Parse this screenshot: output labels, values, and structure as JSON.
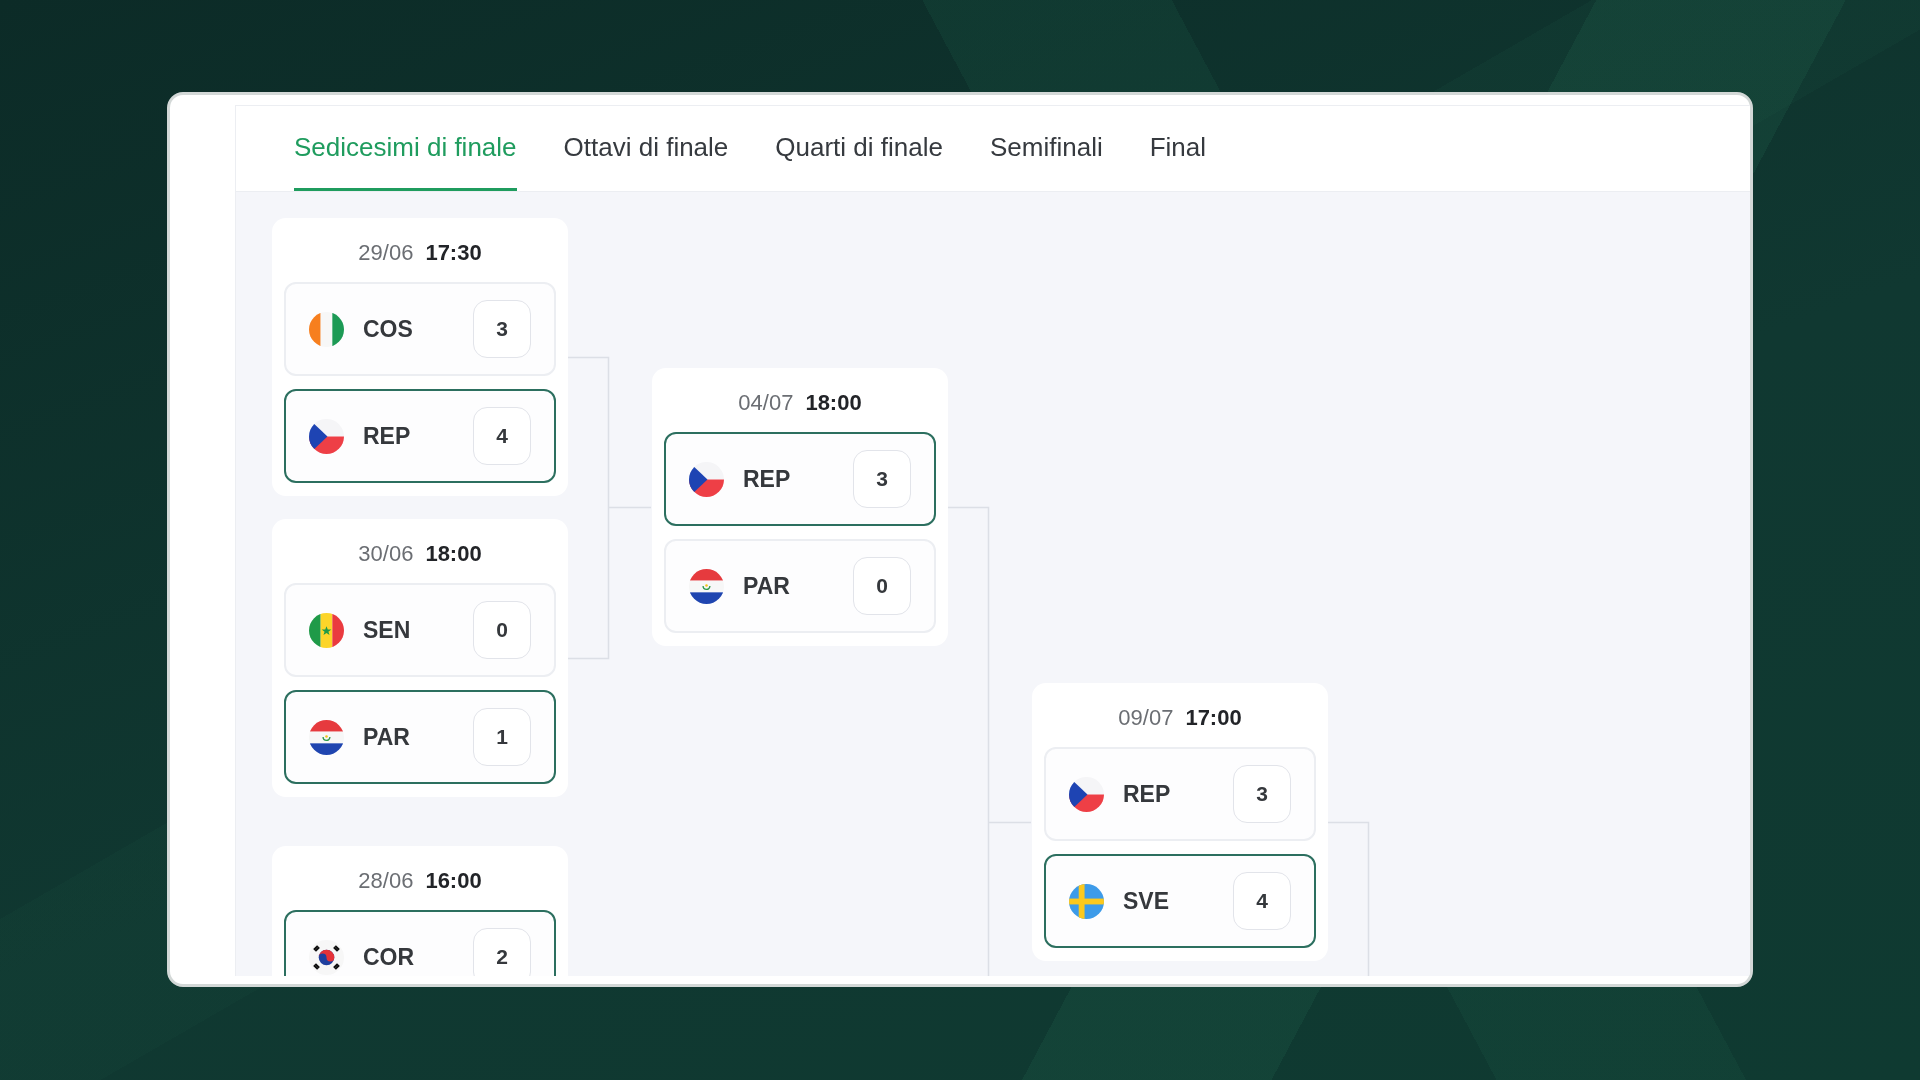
{
  "tabs": [
    {
      "label": "Sedicesimi di finale",
      "selected": true
    },
    {
      "label": "Ottavi di finale",
      "selected": false
    },
    {
      "label": "Quarti di finale",
      "selected": false
    },
    {
      "label": "Semifinali",
      "selected": false
    },
    {
      "label": "Final",
      "selected": false
    }
  ],
  "bracket": {
    "rounds": [
      {
        "matches": [
          {
            "date": "29/06",
            "time": "17:30",
            "teams": [
              {
                "kind": "ivorian",
                "name": "COS",
                "score": "3",
                "winner": false
              },
              {
                "kind": "czech",
                "name": "REP",
                "score": "4",
                "winner": true
              }
            ]
          },
          {
            "date": "30/06",
            "time": "18:00",
            "teams": [
              {
                "kind": "senegalese",
                "name": "SEN",
                "score": "0",
                "winner": false
              },
              {
                "kind": "paraguayan",
                "name": "PAR",
                "score": "1",
                "winner": true
              }
            ]
          },
          {
            "date": "28/06",
            "time": "16:00",
            "teams": [
              {
                "kind": "korean",
                "name": "COR",
                "score": "2",
                "winner": true
              }
            ]
          }
        ]
      },
      {
        "matches": [
          {
            "date": "04/07",
            "time": "18:00",
            "teams": [
              {
                "kind": "czech",
                "name": "REP",
                "score": "3",
                "winner": true
              },
              {
                "kind": "paraguayan",
                "name": "PAR",
                "score": "0",
                "winner": false
              }
            ]
          }
        ]
      },
      {
        "matches": [
          {
            "date": "09/07",
            "time": "17:00",
            "teams": [
              {
                "kind": "czech",
                "name": "REP",
                "score": "3",
                "winner": false
              },
              {
                "kind": "swedish",
                "name": "SVE",
                "score": "4",
                "winner": true
              }
            ]
          }
        ]
      }
    ]
  }
}
